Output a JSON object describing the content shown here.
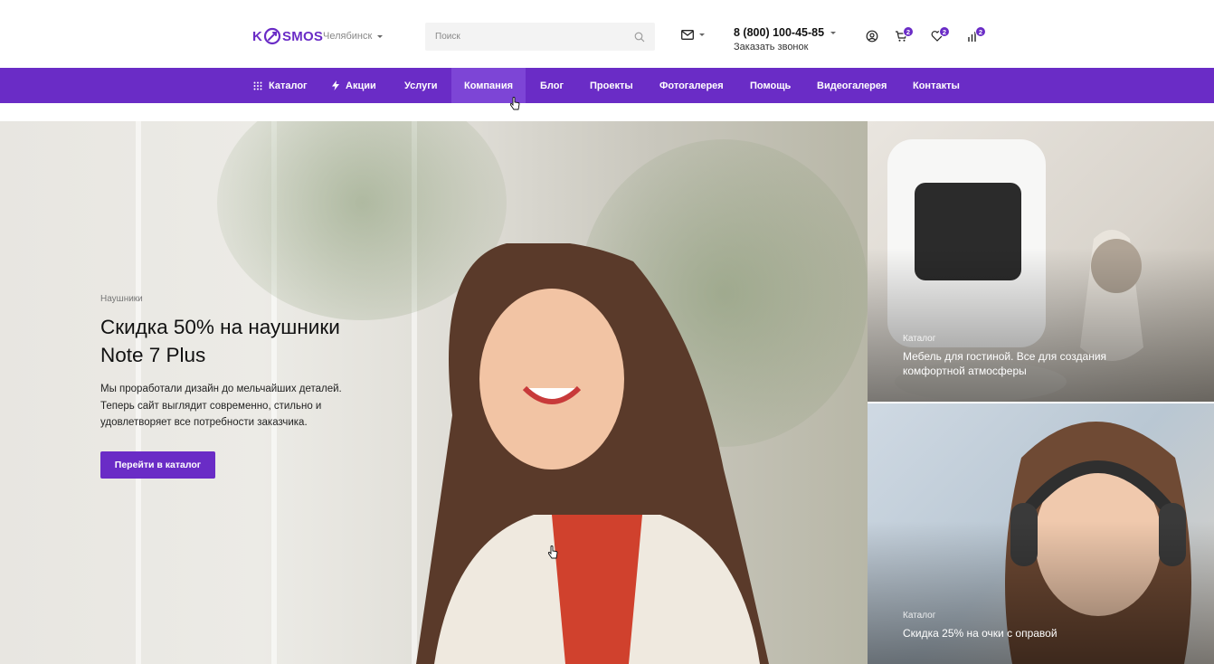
{
  "brand": {
    "logo_pre": "K",
    "logo_post": "SMOS",
    "accent": "#6a2cc6"
  },
  "header": {
    "city": "Челябинск",
    "search_placeholder": "Поиск",
    "phone": "8 (800) 100-45-85",
    "callback": "Заказать звонок",
    "cart_count": "2",
    "favorites_count": "2",
    "compare_count": "2"
  },
  "nav": {
    "items": [
      {
        "label": "Каталог"
      },
      {
        "label": "Акции"
      },
      {
        "label": "Услуги"
      },
      {
        "label": "Компания"
      },
      {
        "label": "Блог"
      },
      {
        "label": "Проекты"
      },
      {
        "label": "Фотогалерея"
      },
      {
        "label": "Помощь"
      },
      {
        "label": "Видеогалерея"
      },
      {
        "label": "Контакты"
      }
    ],
    "active": "Компания"
  },
  "hero": {
    "category": "Наушники",
    "title_line1": "Скидка 50% на наушники",
    "title_line2": "Note 7 Plus",
    "desc_line1": "Мы проработали дизайн до мельчайших деталей.",
    "desc_line2": "Теперь сайт выглядит современно, стильно и",
    "desc_line3": "удовлетворяет все потребности заказчика.",
    "button": "Перейти в каталог"
  },
  "cards": [
    {
      "category": "Каталог",
      "title_line1": "Мебель для гостиной. Все для создания",
      "title_line2": "комфортной атмосферы"
    },
    {
      "category": "Каталог",
      "title_line1": "Скидка 25% на очки с оправой"
    }
  ]
}
